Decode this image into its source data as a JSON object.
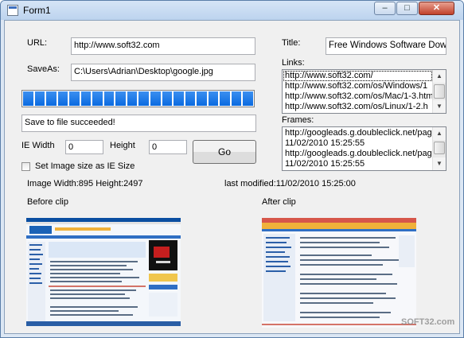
{
  "window": {
    "title": "Form1",
    "minimize_glyph": "–",
    "maximize_glyph": "□",
    "close_glyph": "✕"
  },
  "form": {
    "url_label": "URL:",
    "url_value": "http://www.soft32.com",
    "saveas_label": "SaveAs:",
    "saveas_value": "C:\\Users\\Adrian\\Desktop\\google.jpg",
    "progress_fraction": 1.0,
    "status_text": "Save to file succeeded!",
    "ie_width_label": "IE Width",
    "ie_width_value": "0",
    "height_label": "Height",
    "height_value": "0",
    "go_label": "Go",
    "checkbox_label": "Set Image size as IE Size",
    "checkbox_checked": false,
    "image_size_text": "Image Width:895 Height:2497",
    "last_modified_text": "last modified:11/02/2010 15:25:00",
    "before_clip_label": "Before clip",
    "after_clip_label": "After clip"
  },
  "right": {
    "title_label": "Title:",
    "title_value": "Free Windows Software Downl",
    "links_label": "Links:",
    "links": [
      "http://www.soft32.com/",
      "http://www.soft32.com/os/Windows/1",
      "http://www.soft32.com/os/Mac/1-3.htm",
      "http://www.soft32.com/os/Linux/1-2.h"
    ],
    "frames_label": "Frames:",
    "frames": [
      "http://googleads.g.doubleclick.net/pag",
      "11/02/2010 15:25:55",
      "http://googleads.g.doubleclick.net/pag",
      "11/02/2010 15:25:55"
    ]
  },
  "watermark": "SOFT32.com"
}
